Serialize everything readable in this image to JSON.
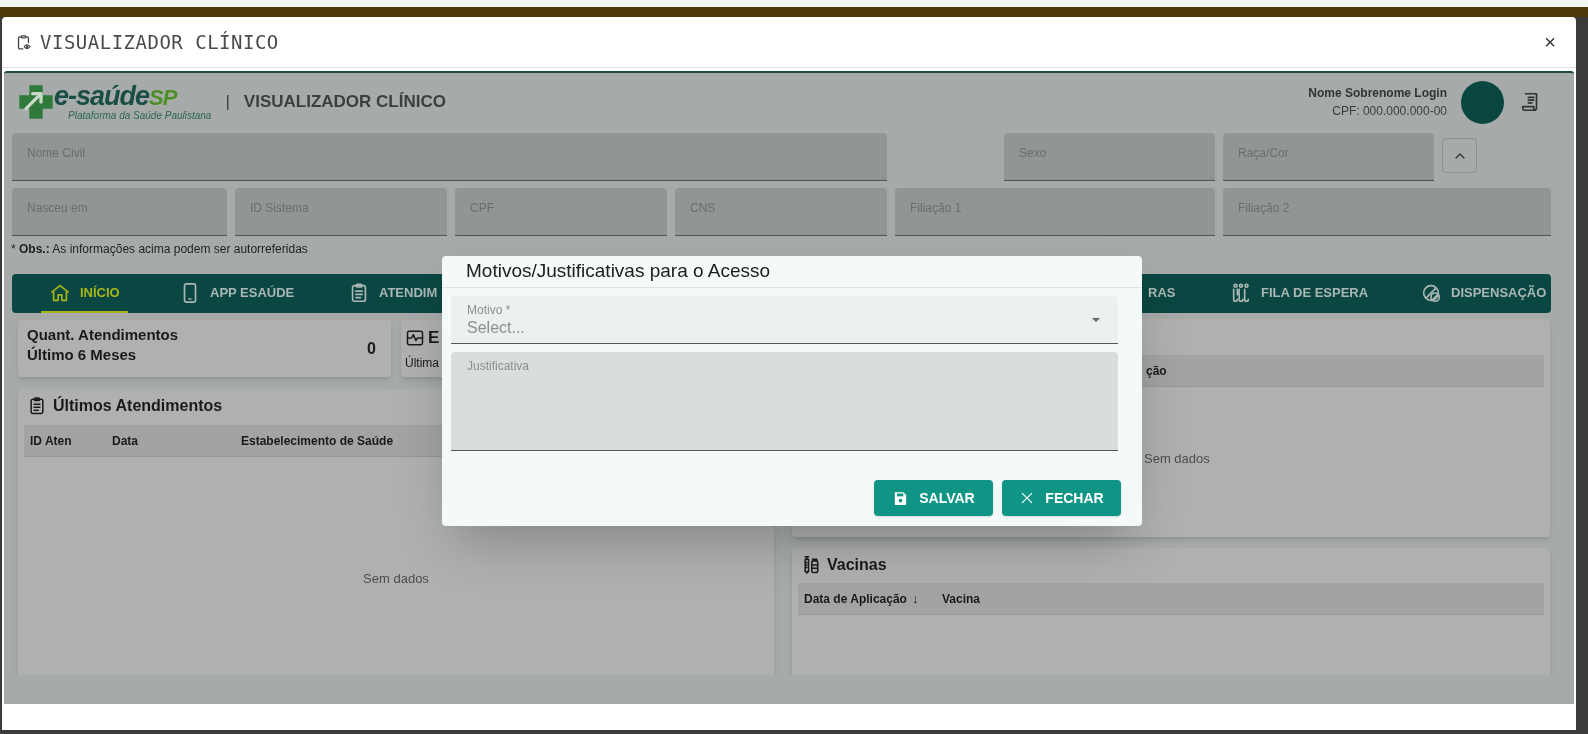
{
  "window": {
    "title": "VISUALIZADOR CLÍNICO",
    "close": "×"
  },
  "header": {
    "logo": {
      "name": "e-saúde",
      "suffix": "SP",
      "tagline": "Plataforma da Saúde Paulistana"
    },
    "separator": "|",
    "title": "VISUALIZADOR CLÍNICO",
    "user": {
      "name": "Nome Sobrenome Login",
      "cpf": "CPF: 000.000.000-00"
    }
  },
  "patient_fields": [
    [
      {
        "label": "Nome Civil"
      },
      {
        "label": "Sexo"
      },
      {
        "label": "Raça/Cor"
      }
    ],
    [
      {
        "label": "Nasceu em"
      },
      {
        "label": "ID Sistema"
      },
      {
        "label": "CPF"
      },
      {
        "label": "CNS"
      },
      {
        "label": "Filiação 1"
      },
      {
        "label": "Filiação 2"
      }
    ]
  ],
  "obs": "* **Obs.:** As informações acima podem ser autorreferidas",
  "tabs": [
    {
      "label": "INÍCIO",
      "selected": true
    },
    {
      "label": "APP ESAÚDE",
      "selected": false
    },
    {
      "label": "ATENDIM",
      "selected": false
    },
    {
      "label": "RAS",
      "selected": false
    },
    {
      "label": "FILA DE ESPERA",
      "selected": false
    },
    {
      "label": "DISPENSAÇÃO",
      "selected": false
    }
  ],
  "summary_cards": [
    {
      "title": [
        "Quant. Atendimentos",
        "Último 6 Meses"
      ],
      "value": "0"
    },
    {
      "title": [
        "E"
      ],
      "subtitle": "Última"
    }
  ],
  "last_visits": {
    "title": "Últimos Atendimentos",
    "columns": [
      "ID Aten",
      "Data",
      "Estabelecimento de Saúde"
    ],
    "empty": "Sem dados"
  },
  "right_panel": {
    "columns": [
      "ção"
    ],
    "empty": "Sem dados"
  },
  "vaccines": {
    "title": "Vacinas",
    "columns": [
      {
        "label": "Data de Aplicação",
        "sort": "↓"
      },
      {
        "label": "Vacina"
      }
    ]
  },
  "dialog": {
    "title": "Motivos/Justificativas para o Acesso",
    "motivo": {
      "label": "Motivo *",
      "placeholder": "Select..."
    },
    "justificativa": {
      "label": "Justificativa"
    },
    "buttons": [
      {
        "label": "SALVAR",
        "kind": "save"
      },
      {
        "label": "FECHAR",
        "kind": "close"
      }
    ]
  }
}
